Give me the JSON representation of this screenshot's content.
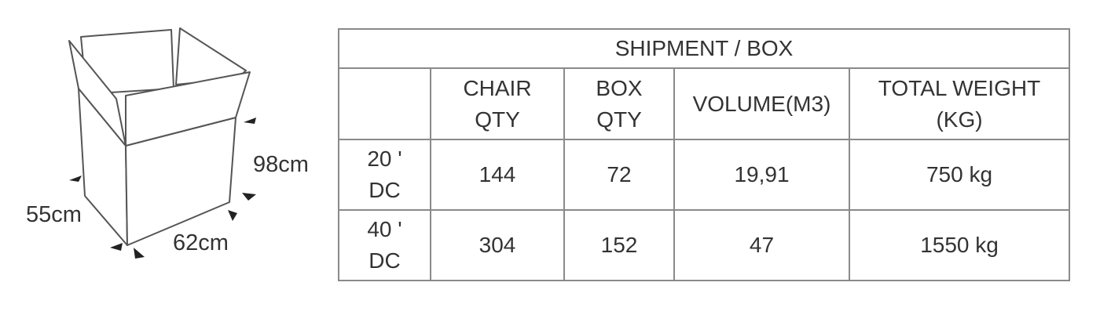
{
  "dimensions": {
    "height": "98cm",
    "depth": "55cm",
    "width": "62cm"
  },
  "table": {
    "title": "SHIPMENT / BOX",
    "headers": [
      "",
      "CHAIR QTY",
      "BOX QTY",
      "VOLUME(M3)",
      "TOTAL WEIGHT (KG)"
    ],
    "rows": [
      {
        "container": "20 ' DC",
        "chair_qty": "144",
        "box_qty": "72",
        "volume": "19,91",
        "total_weight": "750 kg"
      },
      {
        "container": "40 ' DC",
        "chair_qty": "304",
        "box_qty": "152",
        "volume": "47",
        "total_weight": "1550 kg"
      }
    ]
  },
  "colors": {
    "text": "#333333",
    "border": "#8a8a8a",
    "line": "#555555"
  },
  "icons": [
    "open-cardboard-box-icon",
    "dimension-arrow-icon"
  ]
}
